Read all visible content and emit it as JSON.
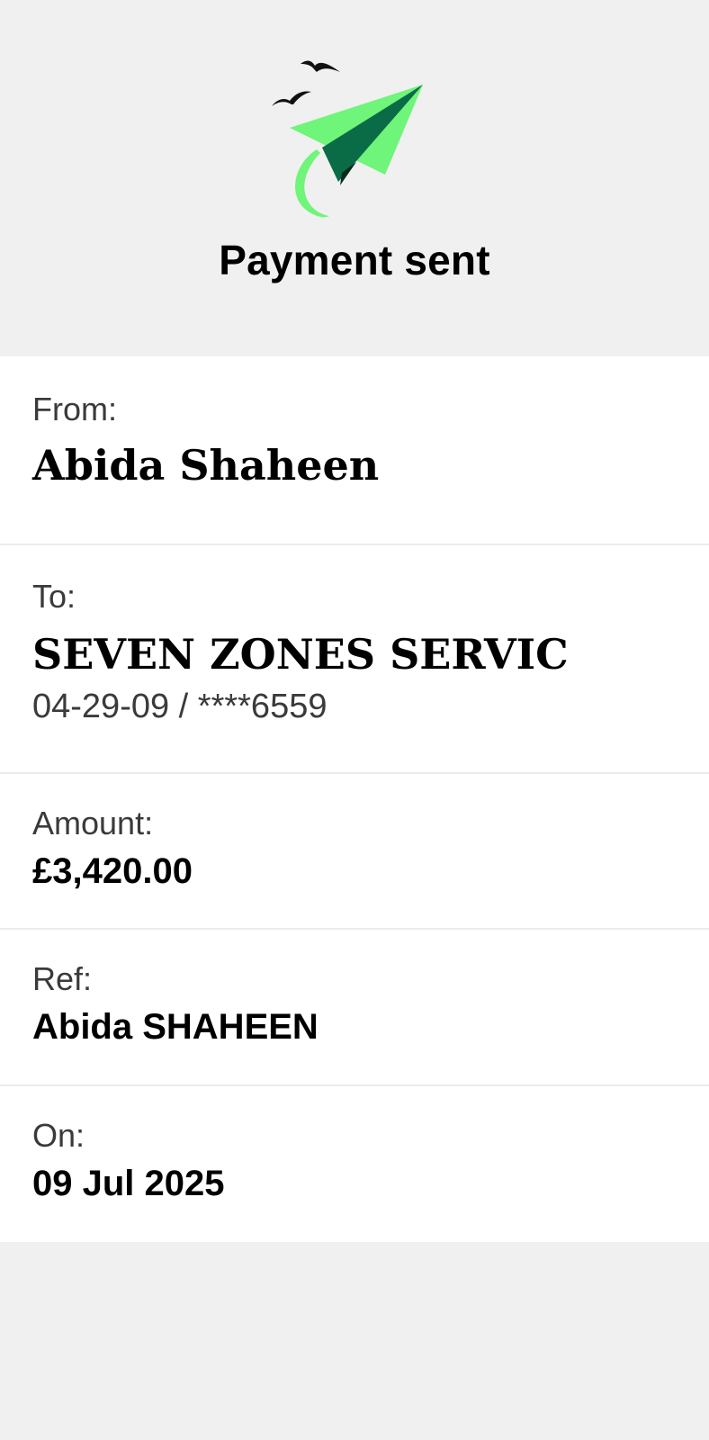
{
  "header": {
    "title": "Payment sent",
    "illustration": "paper-plane-with-birds",
    "colors": {
      "plane_light": "#6ef57a",
      "plane_dark": "#0a6b47",
      "birds": "#111111"
    }
  },
  "details": {
    "from": {
      "label": "From:",
      "value": "Abida Shaheen"
    },
    "to": {
      "label": "To:",
      "value": "SEVEN ZONES SERVIC",
      "account": "04-29-09 / ****6559"
    },
    "amount": {
      "label": "Amount:",
      "value": "£3,420.00"
    },
    "ref": {
      "label": "Ref:",
      "value": "Abida SHAHEEN"
    },
    "on": {
      "label": "On:",
      "value": "09 Jul 2025"
    }
  }
}
